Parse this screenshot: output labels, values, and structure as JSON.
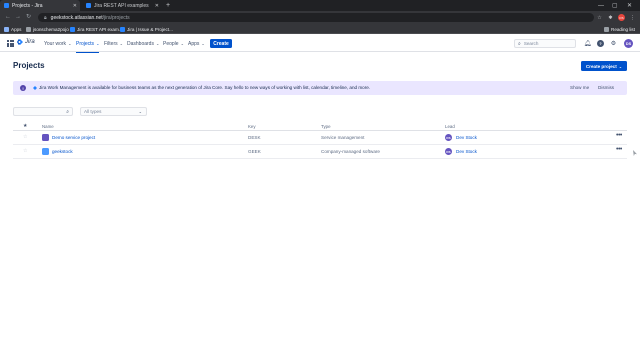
{
  "browser": {
    "tabs": [
      {
        "title": "Projects - Jira",
        "active": true,
        "favicon_color": "#2684ff"
      },
      {
        "title": "Jira REST API examples",
        "active": false,
        "favicon_color": "#2684ff"
      }
    ],
    "new_tab": "+",
    "url_host": "geekstock.atlassian.net",
    "url_path": "/jira/projects",
    "bookmarks": [
      {
        "label": "Apps",
        "color": "#8ab4f8"
      },
      {
        "label": "jsonschema2pojo",
        "color": "#9aa0a6"
      },
      {
        "label": "Jira REST API exam...",
        "color": "#2684ff"
      },
      {
        "label": "Jira | Issue & Project...",
        "color": "#2684ff"
      }
    ],
    "reading_list": "Reading list",
    "profile_initials": "DS"
  },
  "jira_nav": {
    "product": "Jira",
    "items": [
      {
        "label": "Your work",
        "has_caret": true,
        "active": false
      },
      {
        "label": "Projects",
        "has_caret": true,
        "active": true
      },
      {
        "label": "Filters",
        "has_caret": true,
        "active": false
      },
      {
        "label": "Dashboards",
        "has_caret": true,
        "active": false
      },
      {
        "label": "People",
        "has_caret": true,
        "active": false
      },
      {
        "label": "Apps",
        "has_caret": true,
        "active": false
      }
    ],
    "create_label": "Create",
    "search_placeholder": "Search",
    "user_initials": "DS"
  },
  "page": {
    "title": "Projects",
    "create_project_label": "Create project",
    "banner": {
      "message": "Jira Work Management is available for business teams as the next generation of Jira Core. Say hello to new ways of working with list, calendar, timeline, and more.",
      "show_me": "Show me",
      "dismiss": "Dismiss"
    },
    "filter_placeholder": "",
    "type_filter_placeholder": "All types",
    "table": {
      "columns": [
        "Name",
        "Key",
        "Type",
        "Lead"
      ],
      "rows": [
        {
          "name": "Demo service project",
          "key": "DESK",
          "type": "Service management",
          "lead": "Dev Stock",
          "lead_initials": "DS",
          "icon_color": "#6554c0"
        },
        {
          "name": "geekstock",
          "key": "GEEK",
          "type": "Company-managed software",
          "lead": "Dev Stock",
          "lead_initials": "DS",
          "icon_color": "#4c9aff"
        }
      ]
    }
  },
  "colors": {
    "primary": "#0052cc",
    "banner_bg": "#eae6ff",
    "avatar": "#6554c0"
  }
}
